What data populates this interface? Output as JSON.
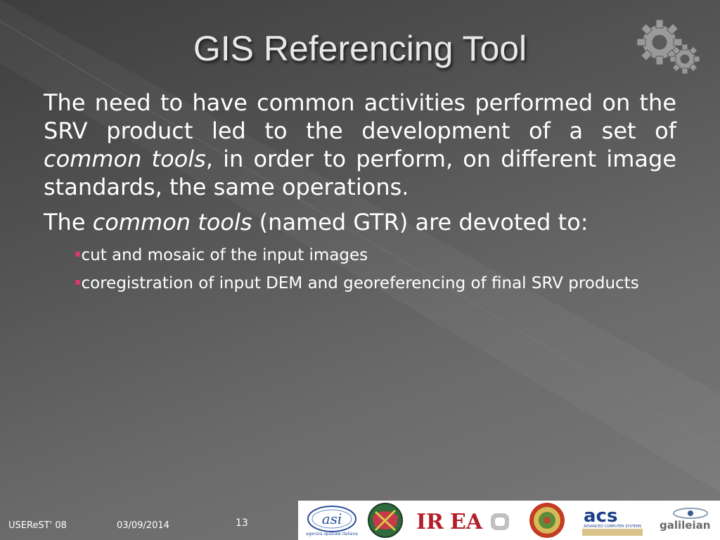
{
  "slide": {
    "title": "GIS Referencing Tool",
    "para1_a": "The need to have common activities performed on the SRV product led to the development of a set of ",
    "para1_em": "common tools",
    "para1_b": ", in order to perform, on different image standards, the same operations.",
    "para2_a": "The ",
    "para2_em": "common tools",
    "para2_b": " (named GTR) are devoted to:",
    "bullets": [
      "cut and mosaic of the input images",
      "coregistration of input DEM and georeferencing of final SRV products"
    ],
    "bullet_marker": "▪"
  },
  "footer": {
    "event": "USEReST' 08",
    "date": "03/09/2014",
    "page": "13"
  },
  "logos": {
    "asi": "asi",
    "asi_sub": "agenzia spaziale italiana",
    "irea": "IREA",
    "acs": "acs",
    "acs_sub": "ADVANCED COMPUTER SYSTEMS",
    "galileian": "galileian"
  },
  "colors": {
    "bullet": "#d23b6a",
    "acs_blue": "#1d3f8a",
    "irea_red": "#b3202b"
  }
}
